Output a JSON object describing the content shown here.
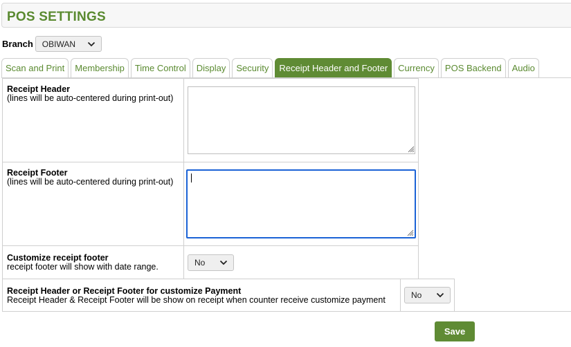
{
  "page": {
    "title": "POS SETTINGS"
  },
  "branch": {
    "label": "Branch",
    "selected": "OBIWAN"
  },
  "tabs": [
    {
      "label": "Scan and Print",
      "active": false
    },
    {
      "label": "Membership",
      "active": false
    },
    {
      "label": "Time Control",
      "active": false
    },
    {
      "label": "Display",
      "active": false
    },
    {
      "label": "Security",
      "active": false
    },
    {
      "label": "Receipt Header and Footer",
      "active": true
    },
    {
      "label": "Currency",
      "active": false
    },
    {
      "label": "POS Backend",
      "active": false
    },
    {
      "label": "Audio",
      "active": false
    }
  ],
  "fields": {
    "receipt_header": {
      "title": "Receipt Header",
      "desc": "(lines will be auto-centered during print-out)",
      "value": ""
    },
    "receipt_footer": {
      "title": "Receipt Footer",
      "desc": "(lines will be auto-centered during print-out)",
      "value": ""
    },
    "customize_footer": {
      "title": "Customize receipt footer",
      "desc": "receipt footer will show with date range.",
      "selected": "No"
    },
    "customize_payment": {
      "title": "Receipt Header or Receipt Footer for customize Payment",
      "desc": "Receipt Header & Receipt Footer will be show on receipt when counter receive customize payment",
      "selected": "No"
    }
  },
  "actions": {
    "save_label": "Save"
  },
  "colors": {
    "accent": "#5f8b34",
    "title": "#5a8a30",
    "focus": "#1a62d6"
  }
}
